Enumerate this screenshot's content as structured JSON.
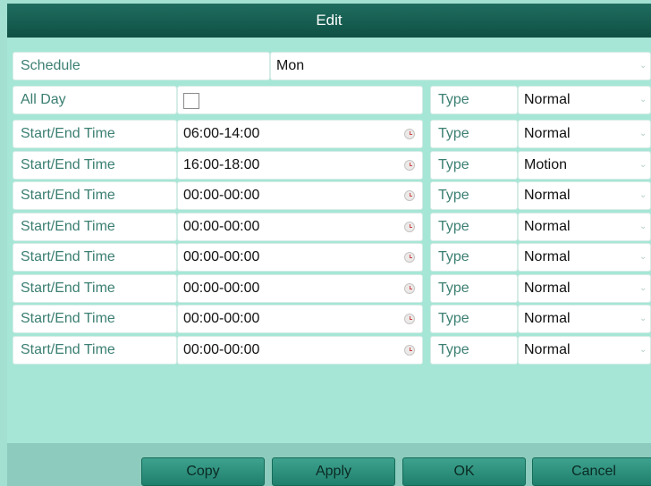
{
  "dialog": {
    "title": "Edit"
  },
  "schedule": {
    "label": "Schedule",
    "value": "Mon"
  },
  "all_day": {
    "label": "All Day",
    "checked": false,
    "type_label": "Type",
    "type_value": "Normal"
  },
  "periods": [
    {
      "label": "Start/End Time",
      "time": "06:00-14:00",
      "type_label": "Type",
      "type_value": "Normal"
    },
    {
      "label": "Start/End Time",
      "time": "16:00-18:00",
      "type_label": "Type",
      "type_value": "Motion"
    },
    {
      "label": "Start/End Time",
      "time": "00:00-00:00",
      "type_label": "Type",
      "type_value": "Normal"
    },
    {
      "label": "Start/End Time",
      "time": "00:00-00:00",
      "type_label": "Type",
      "type_value": "Normal"
    },
    {
      "label": "Start/End Time",
      "time": "00:00-00:00",
      "type_label": "Type",
      "type_value": "Normal"
    },
    {
      "label": "Start/End Time",
      "time": "00:00-00:00",
      "type_label": "Type",
      "type_value": "Normal"
    },
    {
      "label": "Start/End Time",
      "time": "00:00-00:00",
      "type_label": "Type",
      "type_value": "Normal"
    },
    {
      "label": "Start/End Time",
      "time": "00:00-00:00",
      "type_label": "Type",
      "type_value": "Normal"
    }
  ],
  "buttons": {
    "copy": "Copy",
    "apply": "Apply",
    "ok": "OK",
    "cancel": "Cancel"
  },
  "icons": {
    "dropdown": "chevron-down-icon",
    "time_picker": "clock-icon"
  },
  "colors": {
    "title_bar": "#0f5044",
    "panel": "#a6e6d6",
    "label_text": "#3b7f72",
    "button": "#2a8f7a"
  }
}
